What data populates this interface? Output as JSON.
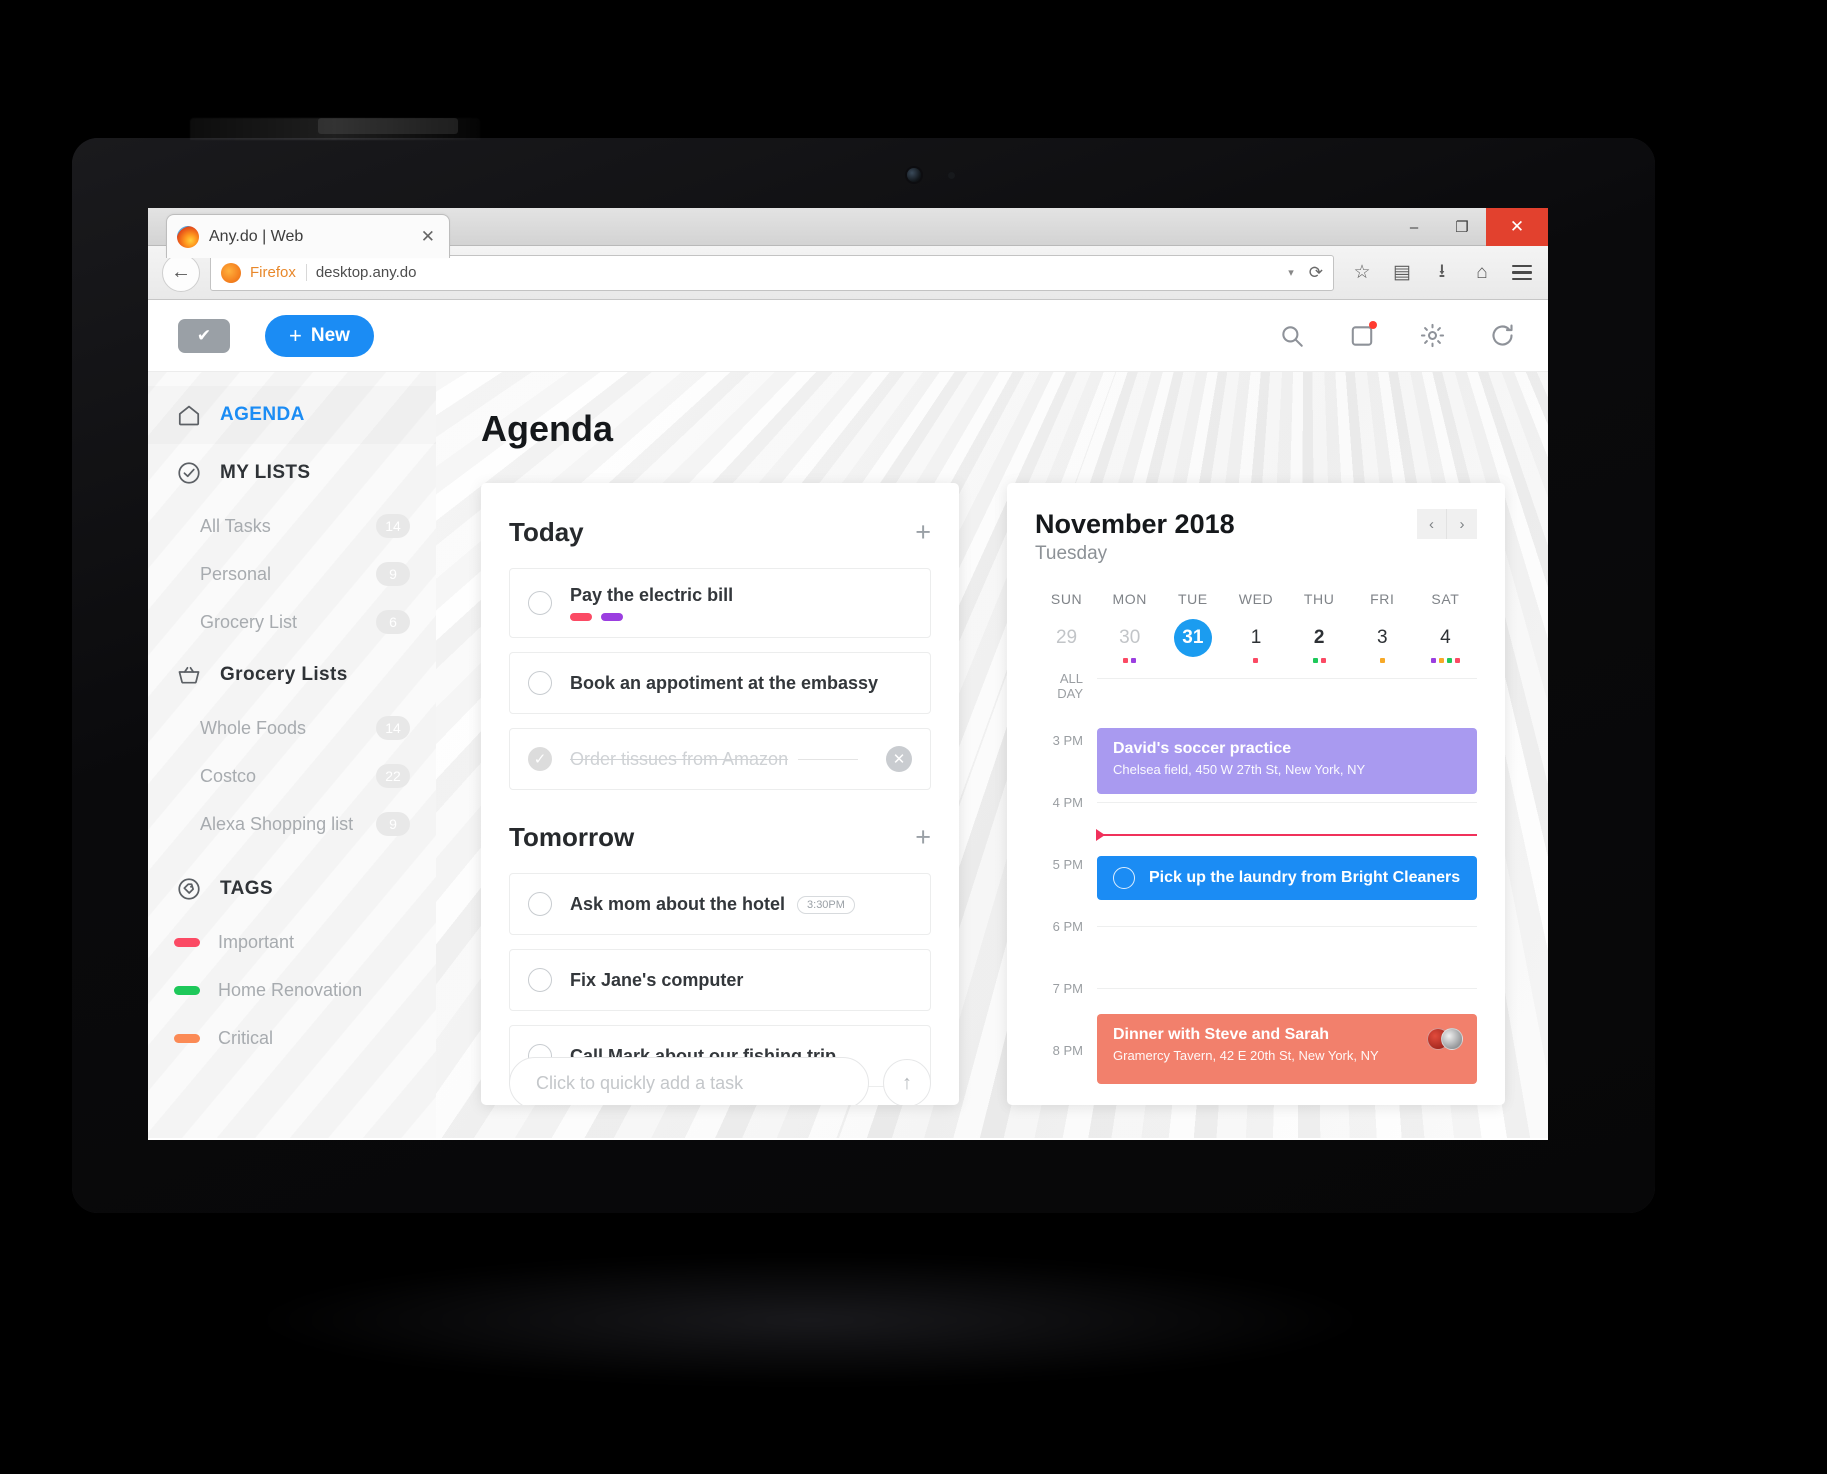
{
  "browser": {
    "tab_title": "Any.do | Web",
    "tab_close_icon": "close-icon",
    "url": "desktop.any.do",
    "url_brand": "Firefox",
    "window_minimize": "–",
    "window_maximize": "❐",
    "window_close": "✕",
    "back_icon": "←",
    "reload_icon": "⟳",
    "dropdown_caret": "▾",
    "nav_icons": [
      "star-icon",
      "reader-icon",
      "download-icon",
      "home-icon",
      "menu-icon"
    ]
  },
  "app_header": {
    "logo_glyph": "✔",
    "new_label": "New",
    "new_plus": "+",
    "search_icon": "⌕",
    "notifications_icon": "▭",
    "settings_icon": "⚙",
    "sync_icon": "⟳"
  },
  "sidebar": {
    "agenda": {
      "label": "AGENDA",
      "icon": "home-icon"
    },
    "my_lists": {
      "label": "MY LISTS",
      "icon": "check-circle-icon",
      "items": [
        {
          "label": "All Tasks",
          "count": "14"
        },
        {
          "label": "Personal",
          "count": "9"
        },
        {
          "label": "Grocery List",
          "count": "6"
        }
      ]
    },
    "grocery_lists": {
      "label": "Grocery Lists",
      "icon": "basket-icon",
      "items": [
        {
          "label": "Whole Foods",
          "count": "14"
        },
        {
          "label": "Costco",
          "count": "22"
        },
        {
          "label": "Alexa Shopping list",
          "count": "9"
        }
      ]
    },
    "tags": {
      "label": "TAGS",
      "icon": "tag-circle-icon",
      "items": [
        {
          "label": "Important",
          "color": "#fb4a64"
        },
        {
          "label": "Home Renovation",
          "color": "#1ec85a"
        },
        {
          "label": "Critical",
          "color": "#fb8a55"
        }
      ]
    }
  },
  "main": {
    "page_title": "Agenda",
    "sections": [
      {
        "title": "Today",
        "add_icon": "+",
        "tasks": [
          {
            "text": "Pay the electric bill",
            "done": false,
            "tags": [
              "#fb4a64",
              "#9b3ee0"
            ],
            "time": ""
          },
          {
            "text": "Book an appotiment at the embassy",
            "done": false,
            "tags": [],
            "time": ""
          },
          {
            "text": "Order tissues from Amazon",
            "done": true,
            "tags": [],
            "time": "",
            "delete_icon": "✕"
          }
        ]
      },
      {
        "title": "Tomorrow",
        "add_icon": "+",
        "tasks": [
          {
            "text": "Ask mom about the hotel",
            "done": false,
            "tags": [],
            "time": "3:30PM"
          },
          {
            "text": "Fix Jane's computer",
            "done": false,
            "tags": [],
            "time": ""
          },
          {
            "text": "Call Mark about our fishing trip",
            "done": false,
            "tags": [],
            "time": ""
          }
        ]
      }
    ],
    "quick_add_placeholder": "Click to quickly add a task",
    "quick_add_send_icon": "↑"
  },
  "calendar": {
    "month": "November 2018",
    "weekday": "Tuesday",
    "prev_icon": "‹",
    "next_icon": "›",
    "day_names": [
      "SUN",
      "MON",
      "TUE",
      "WED",
      "THU",
      "FRI",
      "SAT"
    ],
    "days": [
      {
        "num": "29",
        "muted": true,
        "today": false,
        "bold": false,
        "dots": []
      },
      {
        "num": "30",
        "muted": true,
        "today": false,
        "bold": false,
        "dots": [
          "#fb4a64",
          "#9b3ee0"
        ]
      },
      {
        "num": "31",
        "muted": false,
        "today": true,
        "bold": true,
        "dots": []
      },
      {
        "num": "1",
        "muted": false,
        "today": false,
        "bold": false,
        "dots": [
          "#fb4a64"
        ]
      },
      {
        "num": "2",
        "muted": false,
        "today": false,
        "bold": true,
        "dots": [
          "#1ec85a",
          "#fb4a64"
        ]
      },
      {
        "num": "3",
        "muted": false,
        "today": false,
        "bold": false,
        "dots": [
          "#f7a928"
        ]
      },
      {
        "num": "4",
        "muted": false,
        "today": false,
        "bold": false,
        "dots": [
          "#9b3ee0",
          "#f7a928",
          "#1ec85a",
          "#fb4a64"
        ]
      }
    ],
    "time_labels": [
      "ALL DAY",
      "3 PM",
      "4 PM",
      "5 PM",
      "6 PM",
      "7 PM",
      "8 PM"
    ],
    "events": [
      {
        "title": "David's soccer practice",
        "location": "Chelsea field, 450 W 27th St, New York, NY",
        "color": "#a99af0",
        "type": "event"
      },
      {
        "title": "Pick up the laundry from Bright Cleaners",
        "location": "",
        "color": "#1b8cf4",
        "type": "task"
      },
      {
        "title": "Dinner with Steve and Sarah",
        "location": "Gramercy Tavern, 42 E 20th St, New York, NY",
        "color": "#f2806c",
        "type": "event",
        "attendees": 2
      }
    ],
    "now_indicator_color": "#f0315b"
  }
}
